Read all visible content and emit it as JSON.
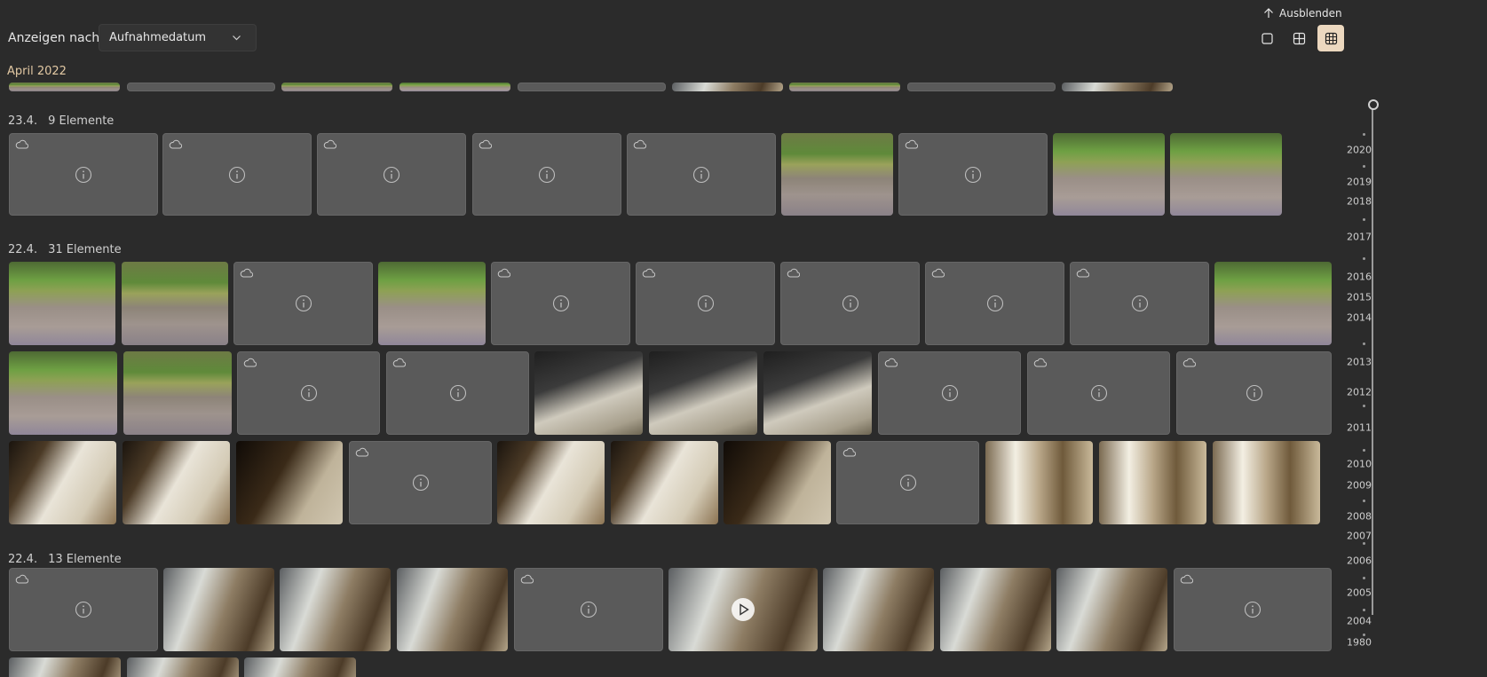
{
  "toolbar": {
    "hide_label": "Ausblenden",
    "sort_label": "Anzeigen nach:",
    "sort_value": "Aufnahmedatum",
    "views": [
      "single-view-icon",
      "medium-grid-icon",
      "small-grid-icon"
    ],
    "active_view": "small-grid-icon"
  },
  "month_title": "April 2022",
  "groups": [
    {
      "date": "23.4.",
      "count": "9 Elemente"
    },
    {
      "date": "22.4.",
      "count": "31 Elemente"
    },
    {
      "date": "22.4.",
      "count": "13 Elemente"
    }
  ],
  "timeline_years": [
    "2020",
    "2019",
    "2018",
    "2017",
    "2016",
    "2015",
    "2014",
    "2013",
    "2012",
    "2011",
    "2010",
    "2009",
    "2008",
    "2007",
    "2006",
    "2005",
    "2004",
    "1980"
  ],
  "colors": {
    "accent": "#ecd8bf",
    "month": "#e3c9a4",
    "background": "#2b2b2b",
    "placeholder": "#5a5a5a"
  }
}
